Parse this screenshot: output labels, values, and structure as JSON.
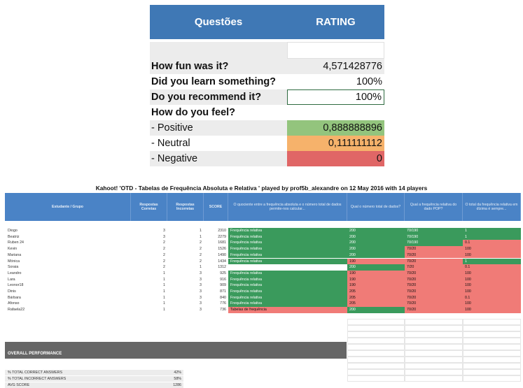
{
  "rating_table": {
    "header": {
      "col1": "Questões",
      "col2": "RATING"
    },
    "rows": [
      {
        "label": "How fun was it?",
        "value": "4,571428776"
      },
      {
        "label": "Did you learn something?",
        "value": "100%"
      },
      {
        "label": "Do you recommend it?",
        "value": "100%"
      },
      {
        "label": "How do you feel?",
        "value": ""
      },
      {
        "label": "- Positive",
        "value": "0,888888896"
      },
      {
        "label": "- Neutral",
        "value": "0,111111112"
      },
      {
        "label": "- Negative",
        "value": "0"
      }
    ]
  },
  "caption": "Kahoot! 'OTD - Tabelas de Frequência Absoluta e Relativa ' played by prof5b_alexandre on 12 May 2016 with 14 players",
  "sheet": {
    "headers": [
      "Estudante / Grupo",
      "Respostas Corretas",
      "Respostas Incorretas",
      "SCORE",
      "O quociente entre a frequência absoluta e o número total de dados permite-nos calcular...",
      "Qual o número total de dados?",
      "Qual a frequência relativa do dado POP?",
      "O total da frequência relativa em dízima é sempre..."
    ],
    "rows": [
      {
        "name": "Diogo",
        "correct": "3",
        "incorrect": "1",
        "score": "2310",
        "q1": "Frequência relativa",
        "q2": "200",
        "q3": "70/190",
        "q4": "1"
      },
      {
        "name": "Beatriz",
        "correct": "3",
        "incorrect": "1",
        "score": "2279",
        "q1": "Frequência relativa",
        "q2": "200",
        "q3": "70/190",
        "q4": "1"
      },
      {
        "name": "Ruben 24",
        "correct": "2",
        "incorrect": "2",
        "score": "1681",
        "q1": "Frequência relativa",
        "q2": "200",
        "q3": "70/190",
        "q4": "0.1"
      },
      {
        "name": "Kevin",
        "correct": "2",
        "incorrect": "2",
        "score": "1526",
        "q1": "Frequência relativa",
        "q2": "200",
        "q3": "70/20",
        "q4": "100"
      },
      {
        "name": "Mariana",
        "correct": "2",
        "incorrect": "2",
        "score": "1490",
        "q1": "Frequência relativa",
        "q2": "200",
        "q3": "70/20",
        "q4": "100"
      },
      {
        "name": "Mónica",
        "correct": "2",
        "incorrect": "2",
        "score": "1434",
        "q1": "Frequência relativa",
        "q2": "190",
        "q3": "70/20",
        "q4": "1"
      },
      {
        "name": "Soraia",
        "correct": "2",
        "incorrect": "1",
        "score": "1312",
        "q1": "",
        "q2": "200",
        "q3": "7/20",
        "q4": "0.1"
      },
      {
        "name": "Leandro",
        "correct": "1",
        "incorrect": "3",
        "score": "925",
        "q1": "Frequência relativa",
        "q2": "190",
        "q3": "70/20",
        "q4": "100"
      },
      {
        "name": "Lara",
        "correct": "1",
        "incorrect": "3",
        "score": "916",
        "q1": "Frequência relativa",
        "q2": "190",
        "q3": "70/20",
        "q4": "100"
      },
      {
        "name": "Leonor18",
        "correct": "1",
        "incorrect": "3",
        "score": "909",
        "q1": "Frequência relativa",
        "q2": "190",
        "q3": "70/20",
        "q4": "100"
      },
      {
        "name": "Dinis",
        "correct": "1",
        "incorrect": "3",
        "score": "871",
        "q1": "Frequência relativa",
        "q2": "205",
        "q3": "70/20",
        "q4": "100"
      },
      {
        "name": "Bárbara",
        "correct": "1",
        "incorrect": "3",
        "score": "840",
        "q1": "Frequência relativa",
        "q2": "205",
        "q3": "70/20",
        "q4": "0.1"
      },
      {
        "name": "Afonso",
        "correct": "1",
        "incorrect": "3",
        "score": "776",
        "q1": "Frequência relativa",
        "q2": "205",
        "q3": "70/20",
        "q4": "100"
      },
      {
        "name": "Rafaela22",
        "correct": "1",
        "incorrect": "3",
        "score": "736",
        "q1": "Tabelas de frequência",
        "q2": "200",
        "q3": "70/20",
        "q4": "100"
      }
    ],
    "overall_label": "OVERALL PERFORMANCE",
    "stats": [
      {
        "label": "% TOTAL CORRECT ANSWERS",
        "value": "42%"
      },
      {
        "label": "% TOTAL INCORRECT ANSWERS",
        "value": "58%"
      },
      {
        "label": "AVG SCORE",
        "value": "1286"
      }
    ]
  },
  "colors": {
    "correct": "#3a9a5c",
    "incorrect": "#f07b77",
    "header": "#4a83c6",
    "rating_header": "#3f78b5"
  }
}
